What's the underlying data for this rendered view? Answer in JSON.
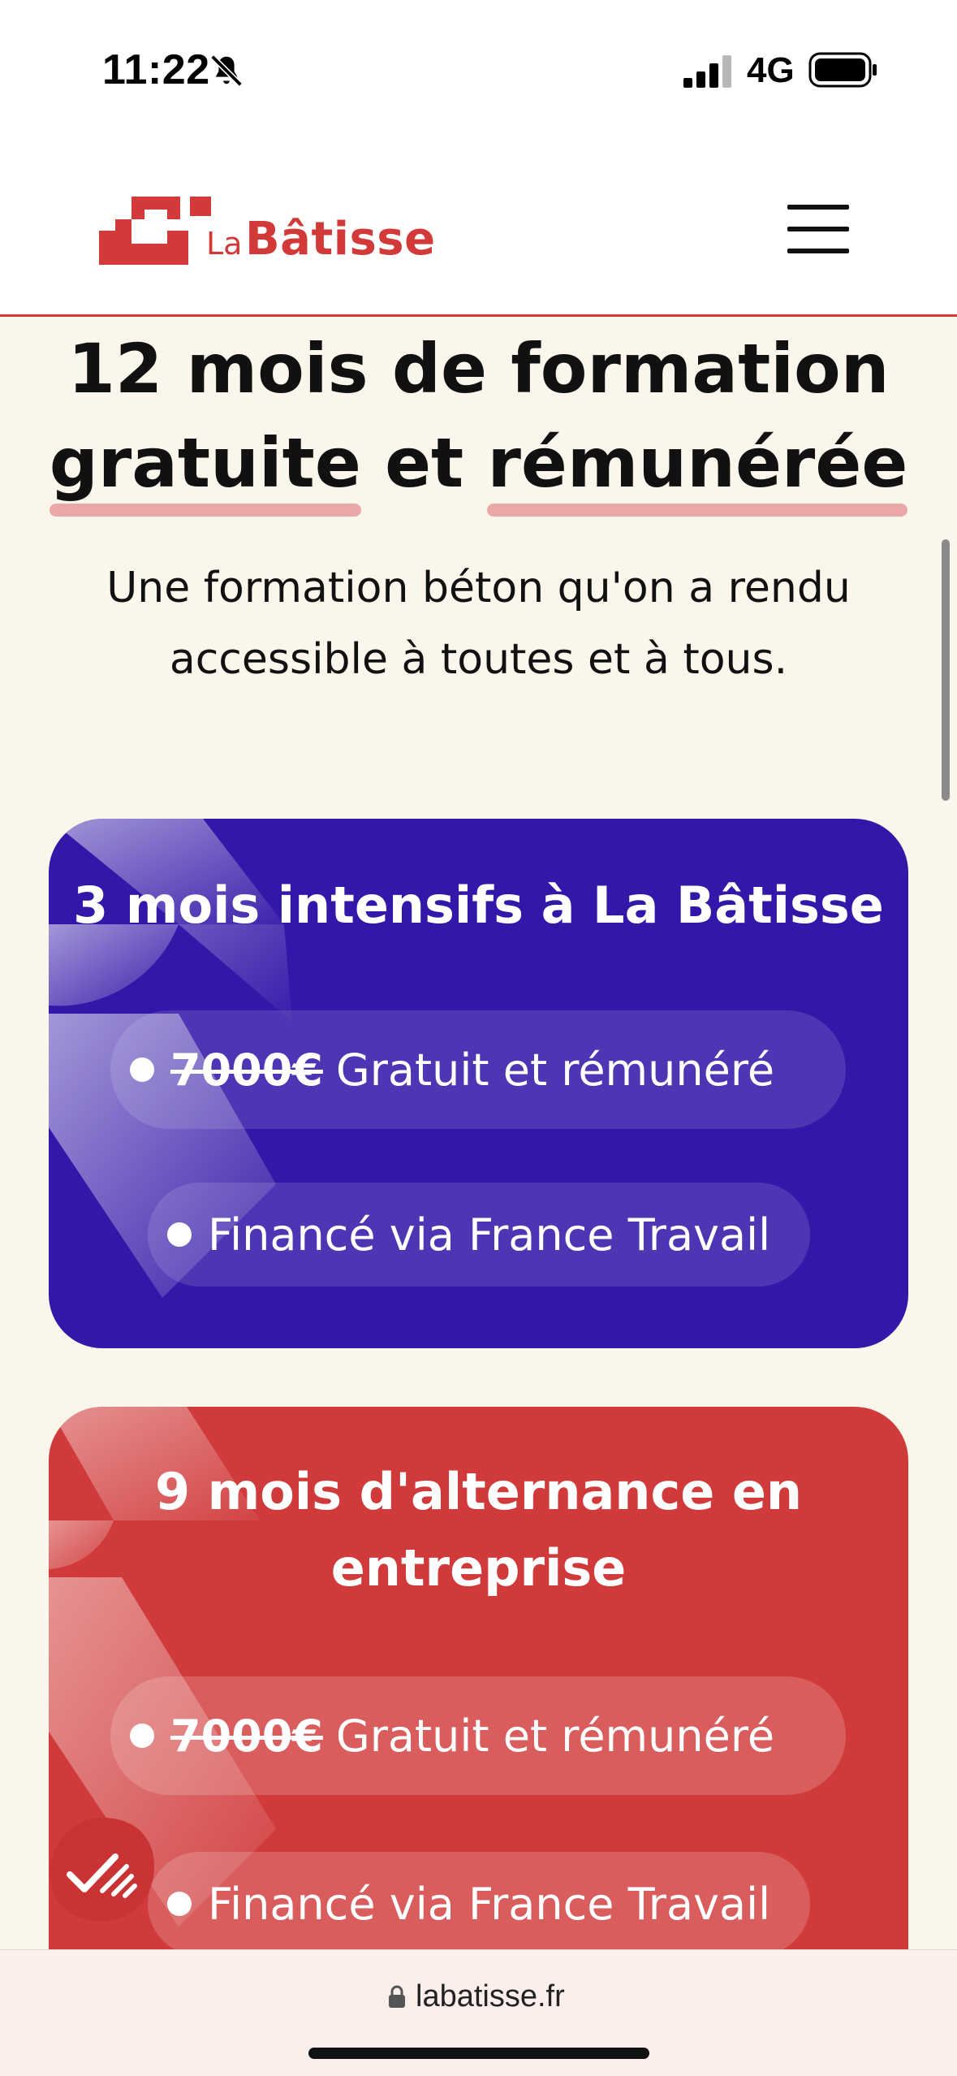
{
  "status_bar": {
    "time": "11:22",
    "network": "4G",
    "icons": [
      "bell-off-icon",
      "signal-icon",
      "battery-icon"
    ]
  },
  "header": {
    "logo_small": "La",
    "logo_big": "Bâtisse",
    "menu_icon": "hamburger-icon"
  },
  "hero": {
    "title_line1": "12 mois de formation",
    "title_word_a": "gratuite",
    "title_word_mid": "et",
    "title_word_b": "rémunérée",
    "subtitle": "Une formation béton qu'on a rendu accessible à toutes et à tous."
  },
  "cards": [
    {
      "title": "3 mois intensifs à La Bâtisse",
      "price_struck": "7000€",
      "price_text": "Gratuit et rémunéré",
      "funding": "Financé via France Travail"
    },
    {
      "title": "9 mois d'alternance en entreprise",
      "price_struck": "7000€",
      "price_text": "Gratuit et rémunéré",
      "funding": "Financé via France Travail"
    }
  ],
  "browser": {
    "url": "labatisse.fr"
  },
  "colors": {
    "brand_red": "#d23a3a",
    "card_blue": "#3317a8",
    "card_red": "#d13a3a",
    "background": "#fbf6ec",
    "highlight": "#eaa7a7"
  }
}
